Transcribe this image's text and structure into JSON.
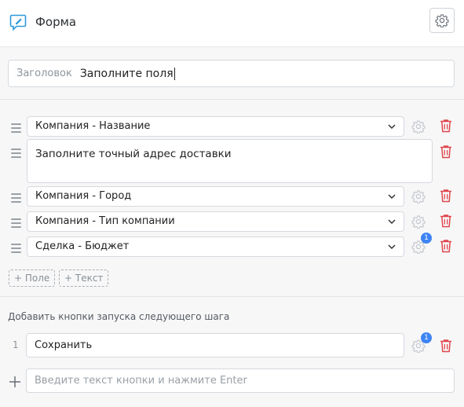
{
  "header": {
    "title": "Форма",
    "logo_icon": "chat-edit-icon",
    "settings_icon": "gear-icon"
  },
  "form_title": {
    "label": "Заголовок",
    "value": "Заполните поля"
  },
  "fields": [
    {
      "type": "select",
      "value": "Компания - Название"
    },
    {
      "type": "text",
      "value": "Заполните точный адрес доставки"
    },
    {
      "type": "select",
      "value": "Компания - Город"
    },
    {
      "type": "select",
      "value": "Компания - Тип компании"
    },
    {
      "type": "select",
      "value": "Сделка - Бюджет",
      "badge": "1"
    }
  ],
  "add_field_label": "+ Поле",
  "add_text_label": "+ Текст",
  "buttons_section": {
    "caption": "Добавить кнопки запуска следующего шага",
    "items": [
      {
        "number": "1",
        "value": "Сохранить",
        "badge": "1"
      }
    ],
    "new_placeholder": "Введите текст кнопки и нажмите Enter"
  },
  "colors": {
    "accent": "#3d84f5",
    "logo": "#2e9ad9",
    "delete": "#e0474c"
  }
}
